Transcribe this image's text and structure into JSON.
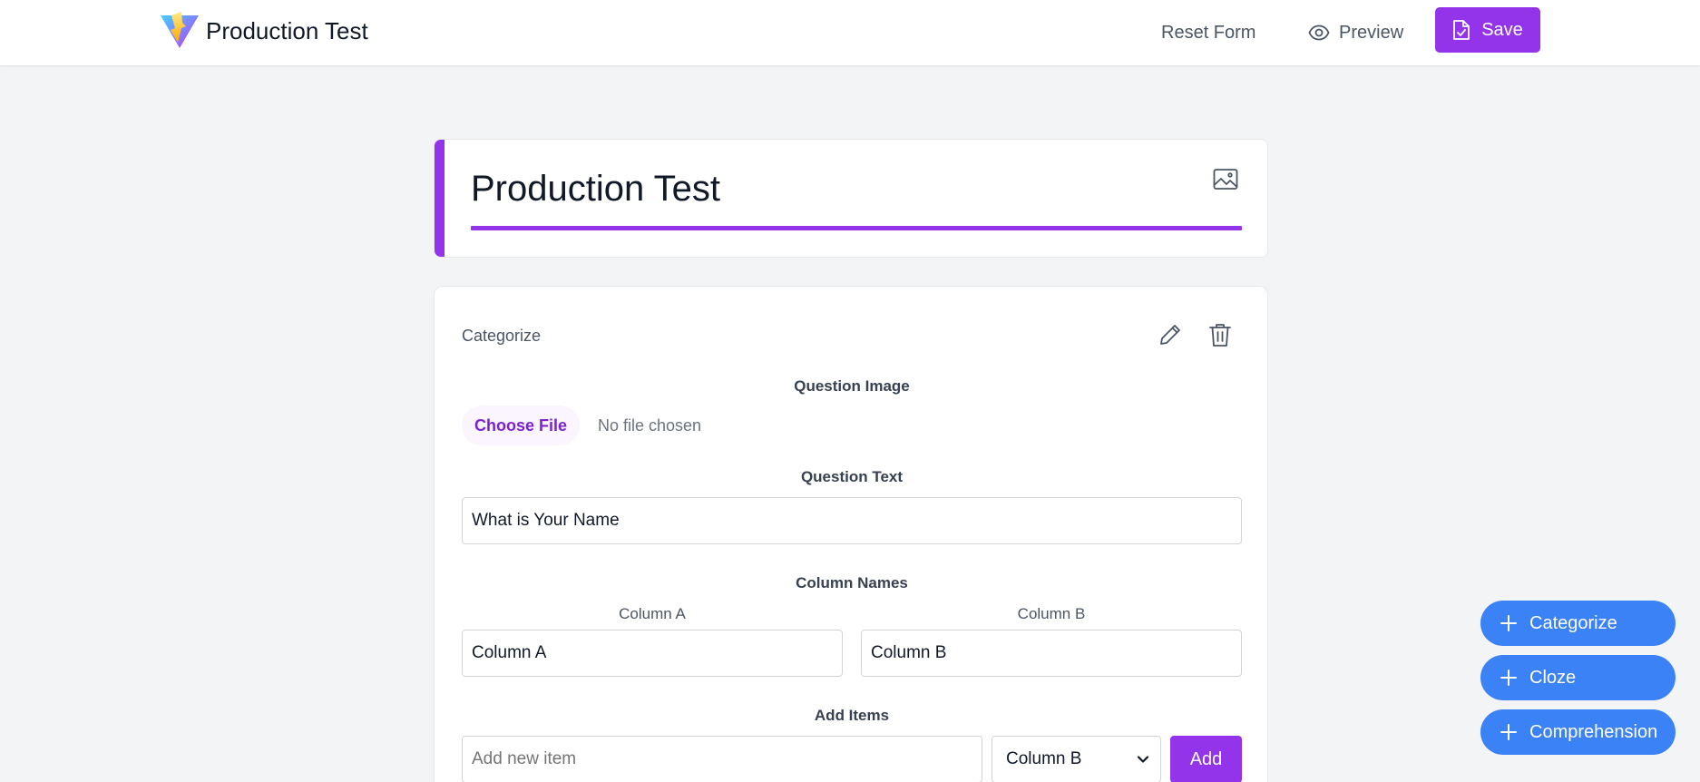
{
  "app": {
    "title": "Production Test"
  },
  "toolbar": {
    "reset_label": "Reset Form",
    "preview_label": "Preview",
    "save_label": "Save"
  },
  "form": {
    "title": "Production Test"
  },
  "question": {
    "type_label": "Categorize",
    "image_section_label": "Question Image",
    "choose_file_label": "Choose File",
    "file_status": "No file chosen",
    "text_section_label": "Question Text",
    "text_value": "What is Your Name",
    "columns_section_label": "Column Names",
    "columns": [
      {
        "label": "Column A",
        "value": "Column A"
      },
      {
        "label": "Column B",
        "value": "Column B"
      }
    ],
    "items_section_label": "Add Items",
    "new_item_placeholder": "Add new item",
    "selected_column": "Column B",
    "add_label": "Add"
  },
  "add_question_buttons": [
    {
      "label": "Categorize"
    },
    {
      "label": "Cloze"
    },
    {
      "label": "Comprehension"
    }
  ],
  "colors": {
    "accent": "#9333ea",
    "fab": "#3b82f6",
    "background": "#f3f4f6"
  },
  "icons": [
    "app-logo-icon",
    "eye-icon",
    "save-file-icon",
    "image-icon",
    "pencil-icon",
    "trash-icon",
    "chevron-down-icon",
    "plus-icon"
  ]
}
